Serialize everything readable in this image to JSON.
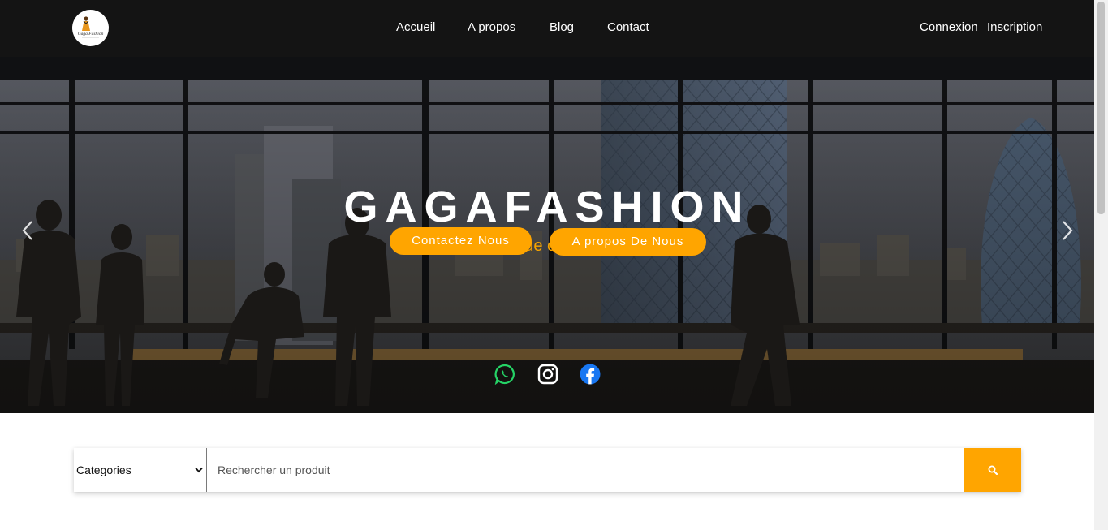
{
  "navbar": {
    "logo_alt": "Gaga Fashion logo",
    "links": [
      "Accueil",
      "A propos",
      "Blog",
      "Contact"
    ],
    "auth": [
      "Connexion",
      "Inscription"
    ]
  },
  "hero": {
    "title": "GAGAFASHION",
    "tagline": "L'afrique c'est chic",
    "buttons": [
      "Contactez Nous",
      "A propos De Nous"
    ],
    "prev_icon": "chevron-left-icon",
    "next_icon": "chevron-right-icon",
    "social": [
      "whatsapp-icon",
      "instagram-icon",
      "facebook-icon"
    ]
  },
  "search": {
    "category_selected": "Categories",
    "placeholder": "Rechercher un produit",
    "button_icon": "search-icon"
  },
  "colors": {
    "accent": "#ffa500",
    "navbar": "#141414",
    "tagline": "#f5a300",
    "whatsapp": "#25d366",
    "facebook": "#1877f2"
  }
}
